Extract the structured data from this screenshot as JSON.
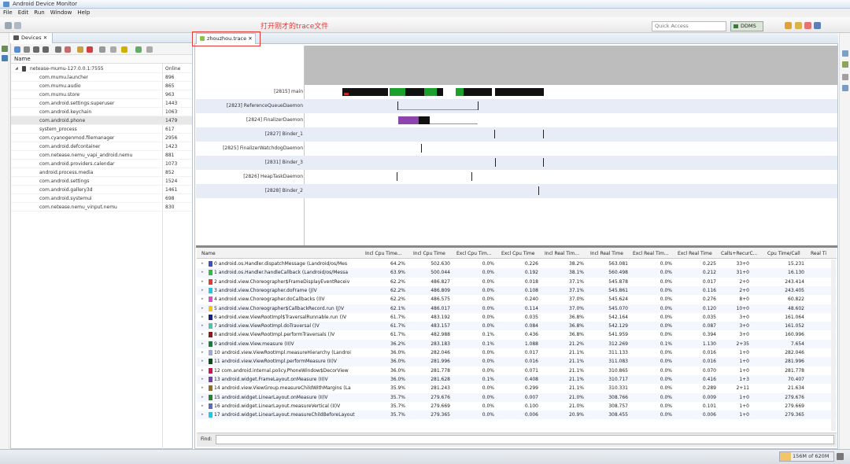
{
  "window": {
    "title": "Android Device Monitor"
  },
  "menu": [
    "File",
    "Edit",
    "Run",
    "Window",
    "Help"
  ],
  "toolbar": {
    "quick_access": "Quick Access",
    "perspective": "DDMS"
  },
  "annotation": "打开刚才的trace文件",
  "devices": {
    "tab_label": "Devices",
    "col_name": "Name",
    "device": {
      "name": "netease-mumu-127.0.0.1:7555",
      "status": "Online"
    },
    "processes": [
      {
        "name": "com.mumu.launcher",
        "pid": "896"
      },
      {
        "name": "com.mumu.audio",
        "pid": "865"
      },
      {
        "name": "com.mumu.store",
        "pid": "963"
      },
      {
        "name": "com.android.settings:superuser",
        "pid": "1443"
      },
      {
        "name": "com.android.keychain",
        "pid": "1063"
      },
      {
        "name": "com.android.phone",
        "pid": "1479"
      },
      {
        "name": "system_process",
        "pid": "617"
      },
      {
        "name": "com.cyanogenmod.filemanager",
        "pid": "2956"
      },
      {
        "name": "com.android.defcontainer",
        "pid": "1423"
      },
      {
        "name": "com.netease.nemu_vapi_android.nemu",
        "pid": "881"
      },
      {
        "name": "com.android.providers.calendar",
        "pid": "1073"
      },
      {
        "name": "android.process.media",
        "pid": "852"
      },
      {
        "name": "com.android.settings",
        "pid": "1524"
      },
      {
        "name": "com.android.gallery3d",
        "pid": "1461"
      },
      {
        "name": "com.android.systemui",
        "pid": "698"
      },
      {
        "name": "com.netease.nemu_vinput.nemu",
        "pid": "830"
      }
    ]
  },
  "trace": {
    "tab_label": "zhouzhou.trace",
    "threads": [
      {
        "label": "[2815] main"
      },
      {
        "label": "[2823] ReferenceQueueDaemon"
      },
      {
        "label": "[2824] FinalizerDaemon"
      },
      {
        "label": "[2827] Binder_1"
      },
      {
        "label": "[2825] FinalizerWatchdogDaemon"
      },
      {
        "label": "[2831] Binder_3"
      },
      {
        "label": "[2826] HeapTaskDaemon"
      },
      {
        "label": "[2828] Binder_2"
      }
    ],
    "columns": [
      "Name",
      "Incl Cpu Time...",
      "Incl Cpu Time",
      "Excl Cpu Tim...",
      "Excl Cpu Time",
      "Incl Real Tim...",
      "Incl Real Time",
      "Excl Real Tim...",
      "Excl Real Time",
      "Calls+RecurC...",
      "Cpu Time/Call",
      "Real Ti"
    ],
    "rows": [
      {
        "color": "#3f51b5",
        "name": "0 android.os.Handler.dispatchMessage (Landroid/os/Mes",
        "v": [
          "64.2%",
          "502.630",
          "0.0%",
          "0.226",
          "38.2%",
          "563.081",
          "0.0%",
          "0.225",
          "33+0",
          "15.231"
        ]
      },
      {
        "color": "#2bbf3c",
        "name": "1 android.os.Handler.handleCallback (Landroid/os/Messa",
        "v": [
          "63.9%",
          "500.044",
          "0.0%",
          "0.192",
          "38.1%",
          "560.498",
          "0.0%",
          "0.212",
          "31+0",
          "16.130"
        ]
      },
      {
        "color": "#e53935",
        "name": "2 android.view.Choreographer$FrameDisplayEventReceiv",
        "v": [
          "62.2%",
          "486.827",
          "0.0%",
          "0.018",
          "37.1%",
          "545.878",
          "0.0%",
          "0.017",
          "2+0",
          "243.414"
        ]
      },
      {
        "color": "#29c5d8",
        "name": "3 android.view.Choreographer.doFrame (J)V",
        "v": [
          "62.2%",
          "486.809",
          "0.0%",
          "0.108",
          "37.1%",
          "545.861",
          "0.0%",
          "0.116",
          "2+0",
          "243.405"
        ]
      },
      {
        "color": "#d54fd6",
        "name": "4 android.view.Choreographer.doCallbacks (I)V",
        "v": [
          "62.2%",
          "486.575",
          "0.0%",
          "0.240",
          "37.0%",
          "545.624",
          "0.0%",
          "0.276",
          "8+0",
          "60.822"
        ]
      },
      {
        "color": "#f0c419",
        "name": "5 android.view.Choreographer$CallbackRecord.run (J)V",
        "v": [
          "62.1%",
          "486.017",
          "0.0%",
          "0.114",
          "37.0%",
          "545.070",
          "0.0%",
          "0.120",
          "10+0",
          "48.602"
        ]
      },
      {
        "color": "#1a237e",
        "name": "6 android.view.ViewRootImpl$TraversalRunnable.run ()V",
        "v": [
          "61.7%",
          "483.192",
          "0.0%",
          "0.035",
          "36.8%",
          "542.164",
          "0.0%",
          "0.035",
          "3+0",
          "161.064"
        ]
      },
      {
        "color": "#4fc3a1",
        "name": "7 android.view.ViewRootImpl.doTraversal ()V",
        "v": [
          "61.7%",
          "483.157",
          "0.0%",
          "0.084",
          "36.8%",
          "542.129",
          "0.0%",
          "0.087",
          "3+0",
          "161.052"
        ]
      },
      {
        "color": "#8b1a1a",
        "name": "8 android.view.ViewRootImpl.performTraversals ()V",
        "v": [
          "61.7%",
          "482.988",
          "0.1%",
          "0.436",
          "36.8%",
          "541.959",
          "0.0%",
          "0.394",
          "3+0",
          "160.996"
        ]
      },
      {
        "color": "#1b7a3a",
        "name": "9 android.view.View.measure (II)V",
        "v": [
          "36.2%",
          "283.183",
          "0.1%",
          "1.088",
          "21.2%",
          "312.269",
          "0.1%",
          "1.130",
          "2+35",
          "7.654"
        ]
      },
      {
        "color": "#9fa8da",
        "name": "10 android.view.ViewRootImpl.measureHierarchy (Landroi",
        "v": [
          "36.0%",
          "282.046",
          "0.0%",
          "0.017",
          "21.1%",
          "311.133",
          "0.0%",
          "0.016",
          "1+0",
          "282.046"
        ]
      },
      {
        "color": "#0d4d1a",
        "name": "11 android.view.ViewRootImpl.performMeasure (II)V",
        "v": [
          "36.0%",
          "281.996",
          "0.0%",
          "0.016",
          "21.1%",
          "311.083",
          "0.0%",
          "0.016",
          "1+0",
          "281.996"
        ]
      },
      {
        "color": "#c2185b",
        "name": "12 com.android.internal.policy.PhoneWindow$DecorView",
        "v": [
          "36.0%",
          "281.778",
          "0.0%",
          "0.071",
          "21.1%",
          "310.865",
          "0.0%",
          "0.070",
          "1+0",
          "281.778"
        ]
      },
      {
        "color": "#7b3fa0",
        "name": "13 android.widget.FrameLayout.onMeasure (II)V",
        "v": [
          "36.0%",
          "281.628",
          "0.1%",
          "0.408",
          "21.1%",
          "310.717",
          "0.0%",
          "0.416",
          "1+3",
          "70.407"
        ]
      },
      {
        "color": "#8d6e2a",
        "name": "14 android.view.ViewGroup.measureChildWithMargins (La",
        "v": [
          "35.9%",
          "281.243",
          "0.0%",
          "0.299",
          "21.1%",
          "310.331",
          "0.0%",
          "0.289",
          "2+11",
          "21.634"
        ]
      },
      {
        "color": "#2e7d32",
        "name": "15 android.widget.LinearLayout.onMeasure (II)V",
        "v": [
          "35.7%",
          "279.676",
          "0.0%",
          "0.007",
          "21.0%",
          "308.766",
          "0.0%",
          "0.009",
          "1+0",
          "279.676"
        ]
      },
      {
        "color": "#5c6bc0",
        "name": "16 android.widget.LinearLayout.measureVertical (II)V",
        "v": [
          "35.7%",
          "279.669",
          "0.0%",
          "0.100",
          "21.0%",
          "308.757",
          "0.0%",
          "0.101",
          "1+0",
          "279.669"
        ]
      },
      {
        "color": "#26c6da",
        "name": "17 android.widget.LinearLayout.measureChildBeforeLayout",
        "v": [
          "35.7%",
          "279.365",
          "0.0%",
          "0.006",
          "20.9%",
          "308.455",
          "0.0%",
          "0.006",
          "1+0",
          "279.365"
        ]
      }
    ],
    "find_label": "Find:"
  },
  "status": {
    "heap": "156M of 620M"
  }
}
